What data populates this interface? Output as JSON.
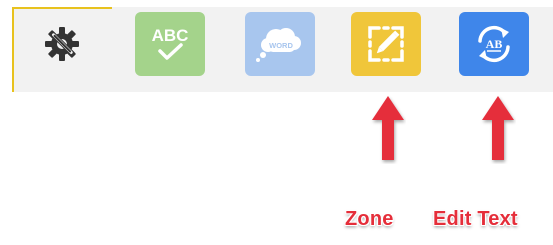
{
  "toolbar": {
    "items": [
      {
        "name": "settings",
        "icon": "gear-wrench-icon",
        "color": "#333333"
      },
      {
        "name": "spellcheck",
        "icon": "abc-check-icon",
        "text": "ABC",
        "color": "#a4d38b"
      },
      {
        "name": "word",
        "icon": "word-cloud-icon",
        "text": "WORD",
        "color": "#a8c6ee"
      },
      {
        "name": "zone",
        "icon": "zone-edit-icon",
        "color": "#f0c63a"
      },
      {
        "name": "edit-text",
        "icon": "ab-refresh-icon",
        "text": "AB",
        "color": "#3f86ea"
      }
    ]
  },
  "callouts": {
    "zone_label": "Zone",
    "edit_text_label": "Edit Text",
    "color": "#e52e3a"
  }
}
